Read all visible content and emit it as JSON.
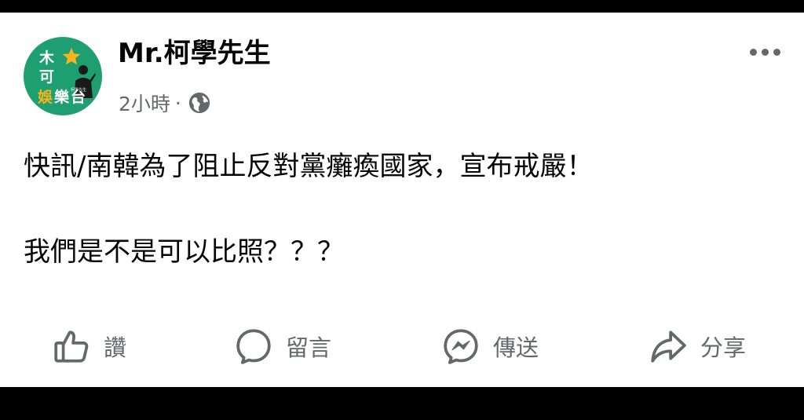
{
  "post": {
    "author": "Mr.柯學先生",
    "time": "2小時",
    "separator": "·",
    "privacy_icon": "globe-icon",
    "more_icon": "more-options-icon",
    "lines": [
      "快訊/南韓為了阻止反對黨癱瘓國家，宣布戒嚴！",
      "我們是不是可以比照？？？"
    ]
  },
  "avatar": {
    "chars": [
      "木",
      "可",
      "娛",
      "樂",
      "台"
    ],
    "small_text": "柯學先生",
    "colors": {
      "background": "#1e9f72",
      "star": "#f5b41c",
      "text": "#ffffff"
    }
  },
  "actions": {
    "like": {
      "label": "讚",
      "icon": "thumbs-up-icon"
    },
    "comment": {
      "label": "留言",
      "icon": "comment-bubble-icon"
    },
    "send": {
      "label": "傳送",
      "icon": "messenger-icon"
    },
    "share": {
      "label": "分享",
      "icon": "share-arrow-icon"
    }
  },
  "colors": {
    "frame": "#000000",
    "card": "#ffffff",
    "text": "#050505",
    "secondary": "#65676b"
  }
}
